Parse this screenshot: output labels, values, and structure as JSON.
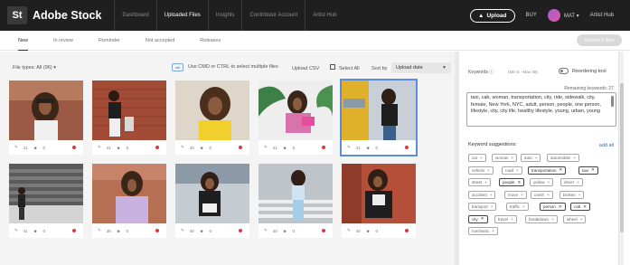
{
  "topbar": {
    "logo": "St",
    "brand": "Adobe Stock",
    "nav": [
      "Dashboard",
      "Uploaded Files",
      "Insights",
      "Contributor Account",
      "Artist Hub"
    ],
    "active_nav": 1,
    "upload_label": "Upload",
    "buy": "BUY",
    "user": "MAT",
    "lang": "Artist Hub"
  },
  "subtabs": {
    "items": [
      "New",
      "In review",
      "Reminder",
      "Not accepted",
      "Releases"
    ],
    "active": 0,
    "submit_label": "Submit 8 files"
  },
  "toolbar": {
    "file_types": "File types: All (96)",
    "ctrl_badge": "ctrl",
    "ctrl_text": "Use CMD or CTRL to select multiple files",
    "upload_csv": "Upload CSV",
    "select_all": "Select All",
    "sort_by": "Sort by",
    "sort_value": "Upload date"
  },
  "tiles": [
    {
      "stat1": "41",
      "stat2": "0",
      "photo": "wall-headphones"
    },
    {
      "stat1": "41",
      "stat2": "0",
      "photo": "brick-suitcase"
    },
    {
      "stat1": "40",
      "stat2": "0",
      "photo": "yellow-laugh"
    },
    {
      "stat1": "41",
      "stat2": "0",
      "photo": "plant-pink"
    },
    {
      "stat1": "41",
      "stat2": "0",
      "photo": "taxi-jacket"
    },
    {
      "stat1": "41",
      "stat2": "0",
      "photo": "shutter-walk"
    },
    {
      "stat1": "36",
      "stat2": "0",
      "photo": "lilac-hoodie"
    },
    {
      "stat1": "40",
      "stat2": "0",
      "photo": "street-leather"
    },
    {
      "stat1": "40",
      "stat2": "0",
      "photo": "crosswalk-blue"
    },
    {
      "stat1": "40",
      "stat2": "0",
      "photo": "red-brick-jacket"
    }
  ],
  "selected_tile": 4,
  "panel": {
    "keywords_label": "Keywords",
    "keywords_count": "(Min 5 - Max 49)",
    "reorder_label": "Reordering tool",
    "remaining": "Remaining keywords: 27",
    "keywords_text": "taxi, cab, woman, transportation, city, ride, sidewalk, city, female, New York, NYC, adult, person, people, one person, lifestyle, city, city life, healthy lifestyle, young, urban, young",
    "suggestions_label": "Keyword suggestions:",
    "add_all": "add all",
    "chips": [
      {
        "label": "car",
        "sel": false
      },
      {
        "label": "woman",
        "sel": false
      },
      {
        "label": "auto",
        "sel": false
      },
      {
        "label": "automobile",
        "sel": false
      },
      {
        "label": "vehicle",
        "sel": false
      },
      {
        "label": "road",
        "sel": false
      },
      {
        "label": "transportation",
        "sel": true
      },
      {
        "label": "taxi",
        "sel": true
      },
      {
        "label": "street",
        "sel": false
      },
      {
        "label": "people",
        "sel": true
      },
      {
        "label": "yellow",
        "sel": false
      },
      {
        "label": "driver",
        "sel": false
      },
      {
        "label": "accident",
        "sel": false
      },
      {
        "label": "move",
        "sel": false
      },
      {
        "label": "crash",
        "sel": false
      },
      {
        "label": "broken",
        "sel": false
      },
      {
        "label": "transport",
        "sel": false
      },
      {
        "label": "traffic",
        "sel": false
      },
      {
        "label": "person",
        "sel": true
      },
      {
        "label": "cab",
        "sel": true
      },
      {
        "label": "city",
        "sel": true
      },
      {
        "label": "travel",
        "sel": false
      },
      {
        "label": "breakdown",
        "sel": false
      },
      {
        "label": "wheel",
        "sel": false
      },
      {
        "label": "mechanic",
        "sel": false
      }
    ]
  }
}
